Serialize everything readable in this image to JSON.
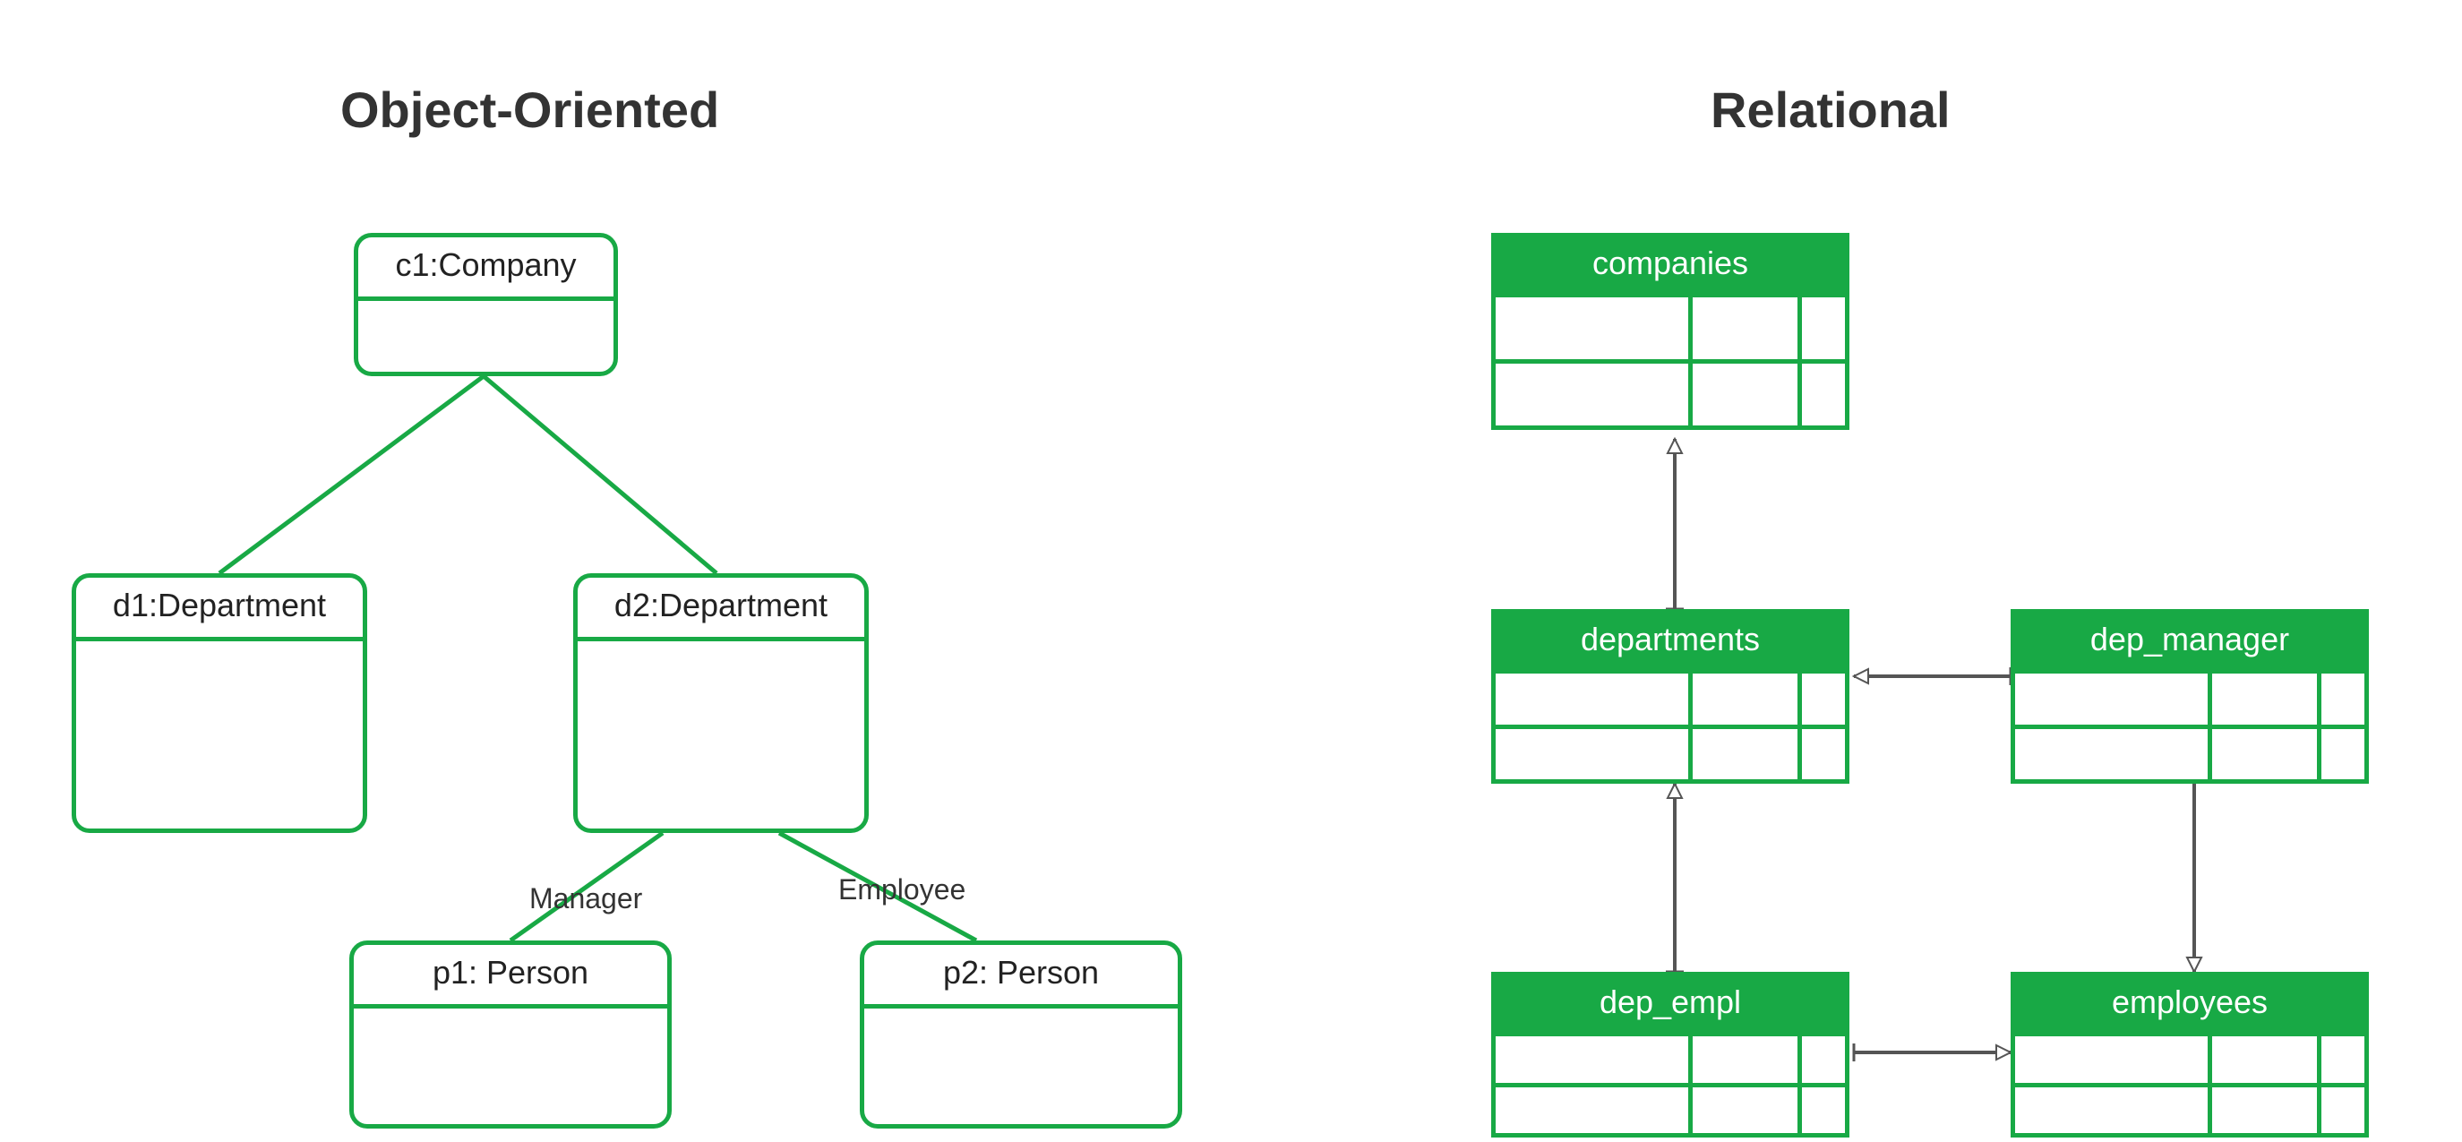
{
  "titles": {
    "oo": "Object-Oriented",
    "rel": "Relational"
  },
  "oo": {
    "c1": "c1:Company",
    "d1": "d1:Department",
    "d2": "d2:Department",
    "p1": "p1: Person",
    "p2": "p2: Person",
    "managerLabel": "Manager",
    "employeeLabel": "Employee"
  },
  "rel": {
    "companies": "companies",
    "departments": "departments",
    "dep_manager": "dep_manager",
    "dep_empl": "dep_empl",
    "employees": "employees"
  },
  "colors": {
    "green": "#18a945",
    "text": "#2f2f2f",
    "arrow": "#555"
  }
}
